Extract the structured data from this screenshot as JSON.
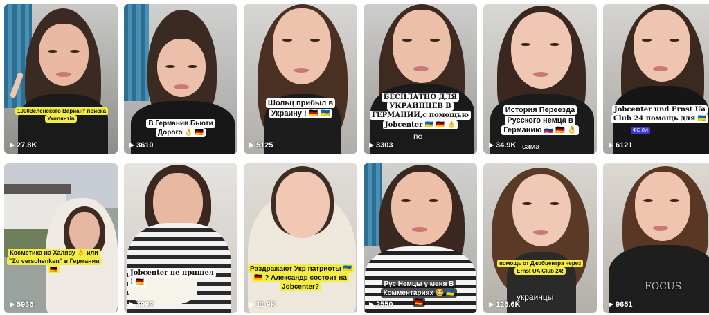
{
  "grid": {
    "tiles": [
      {
        "caption": "1000Зеленского Вариант поиска Укилянтів",
        "views": "27.8K"
      },
      {
        "caption": "В Германии Бьюти Дорого 👌 🇩🇪",
        "views": "3610"
      },
      {
        "caption": "Шольц прибыл в Украину ! 🇩🇪 🇺🇦",
        "views": "5125"
      },
      {
        "caption": "БЕСПЛАТНО ДЛЯ УКРАИНЦЕВ В ГЕРМАНИИ,с помощью Jobcenter 🇺🇦 🇩🇪 👌",
        "views": "3303",
        "subtitle": "по"
      },
      {
        "caption": "История Переезда Русского немца в Германию 🇷🇺 🇩🇪 👌",
        "views": "34.9K",
        "subtitle": "сама"
      },
      {
        "caption": "Jobcenter und Ernst Ua Club 24 помощь для 🇺🇦",
        "views": "6121",
        "badge": "ФС ЛИ"
      },
      {
        "caption": "Косметика на Халяву 👌 или \"Zu verschenken\" в Германии 🇩🇪",
        "views": "5936"
      },
      {
        "caption": "Jobcenter не пришел ! 🇩🇪",
        "views": "3992"
      },
      {
        "caption": "Раздражают Укр патриоты 🇺🇦 🇩🇪 ? Александр состоит на Jobcenter?",
        "views": "11.9K"
      },
      {
        "caption": "Рус Немцы у меня В Комментариях 😂 🇺🇦 🇩🇪",
        "views": "2550"
      },
      {
        "caption": "помощь от Джобцентра через Ernst UA Club 24!",
        "views": "126.6K",
        "subtitle": "украинцы"
      },
      {
        "caption": "",
        "views": "9651",
        "shirt_text": "FOCUS"
      }
    ]
  }
}
